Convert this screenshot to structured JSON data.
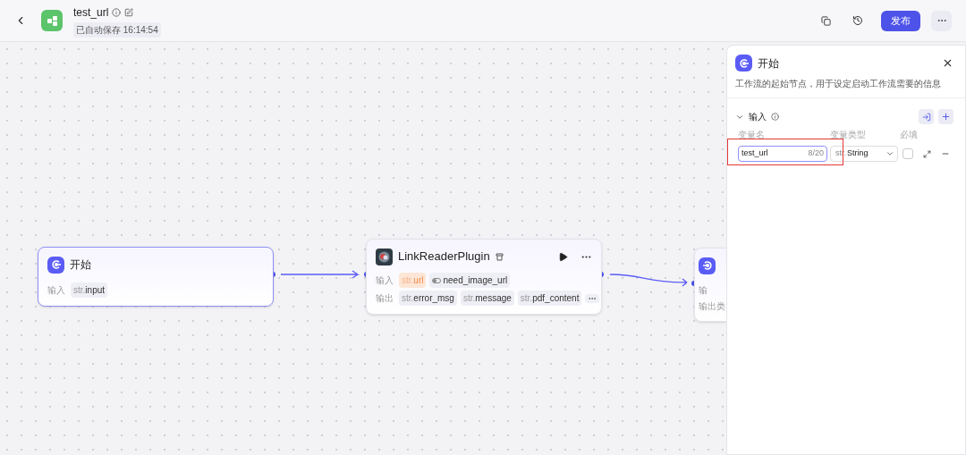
{
  "header": {
    "title": "test_url",
    "autosave": "已自动保存 16:14:54",
    "publish": "发布"
  },
  "nodes": [
    {
      "kind": "start",
      "title": "开始",
      "rows": [
        {
          "label": "输入",
          "tags": [
            {
              "kind": "str",
              "prefix": "str.",
              "name": "input",
              "highlighted": false
            }
          ]
        }
      ]
    },
    {
      "kind": "plugin",
      "title": "LinkReaderPlugin",
      "rows": [
        {
          "label": "输入",
          "tags": [
            {
              "kind": "str",
              "prefix": "str.",
              "name": "url",
              "highlighted": true
            },
            {
              "kind": "bool",
              "name": "need_image_url",
              "highlighted": false
            }
          ]
        },
        {
          "label": "输出",
          "tags": [
            {
              "kind": "str",
              "prefix": "str.",
              "name": "error_msg",
              "highlighted": false
            },
            {
              "kind": "str",
              "prefix": "str.",
              "name": "message",
              "highlighted": false
            },
            {
              "kind": "str",
              "prefix": "str.",
              "name": "pdf_content",
              "highlighted": false
            }
          ],
          "more": true
        }
      ]
    },
    {
      "kind": "end",
      "rows": [
        {
          "label": "输",
          "tags": []
        },
        {
          "label": "输出类",
          "tags": []
        }
      ]
    }
  ],
  "panel": {
    "title": "开始",
    "description": "工作流的起始节点，用于设定启动工作流需要的信息",
    "section": "输入",
    "expanded": true,
    "columns": [
      "变量名",
      "变量类型",
      "必填"
    ],
    "variables": [
      {
        "name": "test_url",
        "counter": "8/20",
        "type_prefix": "str.",
        "type": "String",
        "required": false,
        "highlighted": true
      }
    ]
  }
}
